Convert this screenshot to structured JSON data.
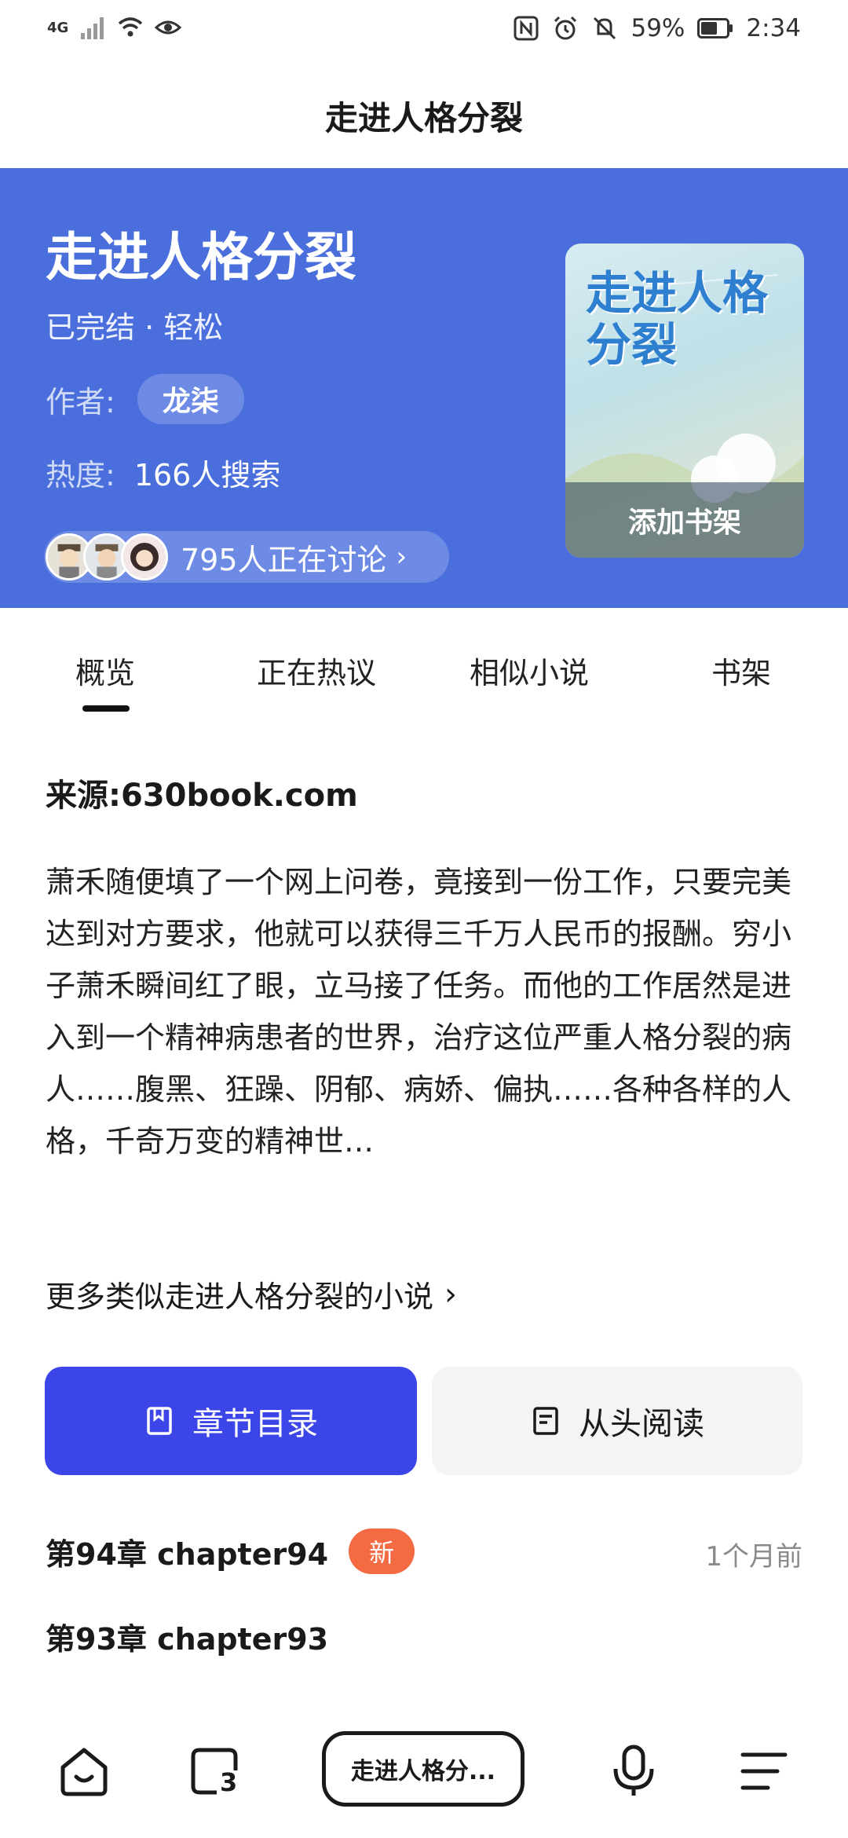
{
  "status_bar": {
    "network": "4G",
    "battery": "59%",
    "time": "2:34"
  },
  "header": {
    "title": "走进人格分裂"
  },
  "book": {
    "title": "走进人格分裂",
    "status": "已完结 · 轻松",
    "author_label": "作者:",
    "author": "龙柒",
    "heat_label": "热度:",
    "heat_value": "166人搜索",
    "discussion": "795人正在讨论",
    "add_to_shelf": "添加书架",
    "cover_title": "走进人格分裂"
  },
  "tabs": [
    "概览",
    "正在热议",
    "相似小说",
    "书架"
  ],
  "overview": {
    "source_label": "来源:",
    "source": "630book.com",
    "summary": "萧禾随便填了一个网上问卷，竟接到一份工作，只要完美达到对方要求，他就可以获得三千万人民币的报酬。穷小子萧禾瞬间红了眼，立马接了任务。而他的工作居然是进入到一个精神病患者的世界，治疗这位严重人格分裂的病人……腹黑、狂躁、阴郁、病娇、偏执……各种各样的人格，千奇万变的精神世…",
    "more_similar": "更多类似走进人格分裂的小说"
  },
  "actions": {
    "toc": "章节目录",
    "read_from_start": "从头阅读"
  },
  "chapters": [
    {
      "title": "第94章 chapter94",
      "badge": "新",
      "time": "1个月前"
    },
    {
      "title": "第93章 chapter93"
    }
  ],
  "bottom_nav": {
    "tab_count": "3",
    "current_tab": "走进人格分..."
  },
  "colors": {
    "hero_bg": "#4a6fdc",
    "primary_button": "#3b45e8",
    "new_badge": "#f46a42"
  },
  "icons": [
    "signal-icon",
    "wifi-icon",
    "eye-icon",
    "nfc-icon",
    "alarm-icon",
    "mute-icon",
    "battery-icon",
    "book-icon",
    "document-icon",
    "home-icon",
    "tabs-icon",
    "microphone-icon",
    "menu-icon",
    "chevron-right-icon"
  ]
}
